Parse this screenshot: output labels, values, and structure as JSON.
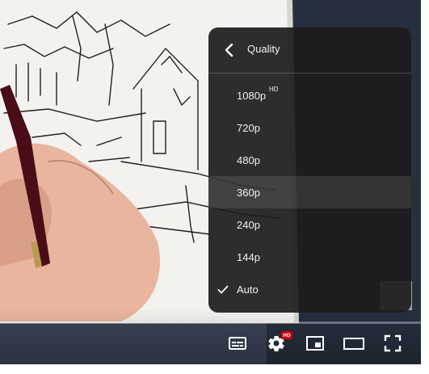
{
  "player": {
    "progress_fraction": 0.0,
    "controls": {
      "subtitles_icon": "subtitles-icon",
      "settings_icon": "settings-gear-icon",
      "settings_badge": "HD",
      "miniplayer_icon": "miniplayer-icon",
      "theater_icon": "theater-mode-icon",
      "fullscreen_icon": "fullscreen-icon"
    }
  },
  "quality_menu": {
    "title": "Quality",
    "back_icon": "chevron-left-icon",
    "selected": "Auto",
    "highlighted": "360p",
    "options": [
      {
        "label": "1080p",
        "badge": "HD"
      },
      {
        "label": "720p",
        "badge": ""
      },
      {
        "label": "480p",
        "badge": ""
      },
      {
        "label": "360p",
        "badge": ""
      },
      {
        "label": "240p",
        "badge": ""
      },
      {
        "label": "144p",
        "badge": ""
      },
      {
        "label": "Auto",
        "badge": ""
      }
    ]
  },
  "colors": {
    "menu_bg": "#1c1c1c",
    "badge_red": "#cc0000",
    "text": "#f1f1f1"
  }
}
